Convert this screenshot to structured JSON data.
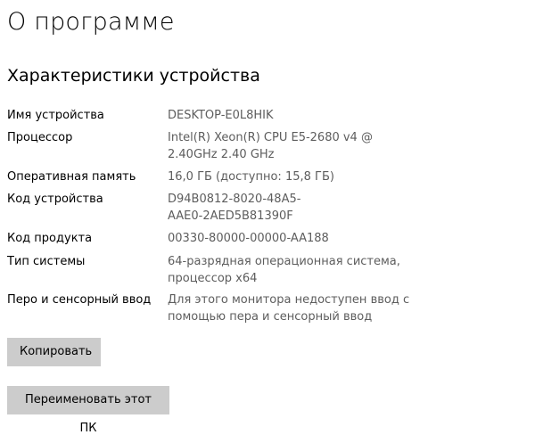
{
  "page": {
    "title": "О программе"
  },
  "section": {
    "title": "Характеристики устройства"
  },
  "specs": [
    {
      "label": "Имя устройства",
      "value": "DESKTOP-E0L8HIK"
    },
    {
      "label": "Процессор",
      "value": "Intel(R) Xeon(R) CPU E5-2680 v4 @\n2.40GHz   2.40 GHz"
    },
    {
      "label": "Оперативная память",
      "value": "16,0 ГБ (доступно: 15,8 ГБ)"
    },
    {
      "label": "Код устройства",
      "value": "D94B0812-8020-48A5-\nAAE0-2AED5B81390F"
    },
    {
      "label": "Код продукта",
      "value": "00330-80000-00000-AA188"
    },
    {
      "label": "Тип системы",
      "value": "64-разрядная операционная система,\nпроцессор x64"
    },
    {
      "label": "Перо и сенсорный ввод",
      "value": "Для этого монитора недоступен ввод с\nпомощью пера и сенсорный ввод"
    }
  ],
  "buttons": {
    "copy_label": "Копировать",
    "rename_label": "Переименовать этот ПК"
  }
}
